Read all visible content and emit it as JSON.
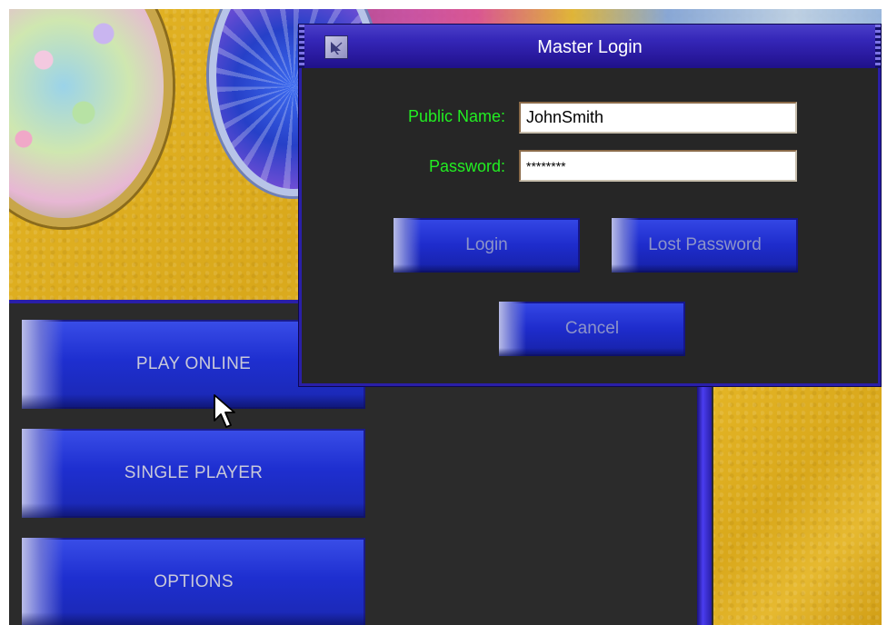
{
  "dialog": {
    "title": "Master Login",
    "public_name_label": "Public Name:",
    "public_name_value": "JohnSmith",
    "password_label": "Password:",
    "password_value": "********",
    "login_label": "Login",
    "lost_password_label": "Lost Password",
    "cancel_label": "Cancel",
    "icon": "pointer-icon"
  },
  "menu": {
    "play_online_label": "PLAY ONLINE",
    "single_player_label": "SINGLE PLAYER",
    "options_label": "OPTIONS"
  },
  "colors": {
    "label_green": "#22ee22",
    "titlebar_blue": "#2a1aa0",
    "button_blue": "#1e2ccc",
    "panel_dark": "#262626",
    "background_gold": "#e4b526"
  },
  "cursor": "arrow-cursor-icon"
}
